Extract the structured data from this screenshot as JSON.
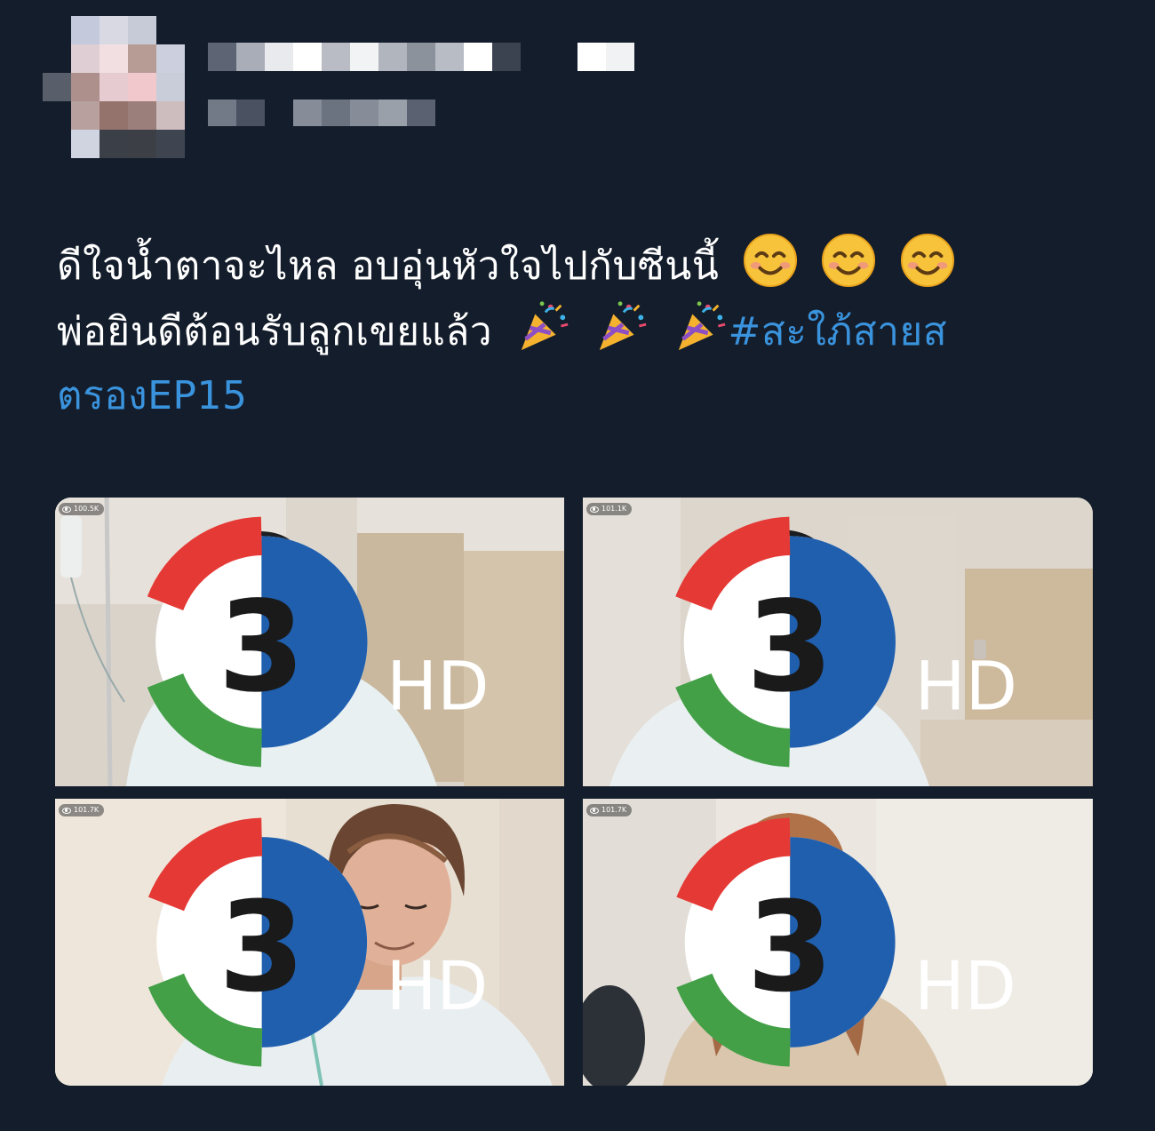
{
  "tweet": {
    "line1": "ดีใจน้ำตาจะไหล อบอุ่นหัวใจไปกับซีนนี้",
    "line2": "พ่อยินดีต้อนรับลูกเขยแล้ว",
    "hashtag_part1": "#สะใภ้สายส",
    "hashtag_part2": "ตรองEP15"
  },
  "emoji": {
    "line1": [
      "smiling-face-emoji",
      "smiling-face-emoji",
      "smiling-face-emoji"
    ],
    "line2": [
      "party-popper-emoji",
      "party-popper-emoji",
      "party-popper-emoji"
    ]
  },
  "media": {
    "images": [
      {
        "views": "100.5K",
        "logo": "channel-3-logo"
      },
      {
        "views": "101.1K",
        "logo": "channel-3-logo"
      },
      {
        "views": "101.7K",
        "logo": "channel-3-logo"
      },
      {
        "views": "101.7K",
        "logo": "channel-3-logo"
      }
    ]
  },
  "colors": {
    "background": "#141d2b",
    "text": "#ffffff",
    "hashtag": "#3a93dd"
  }
}
